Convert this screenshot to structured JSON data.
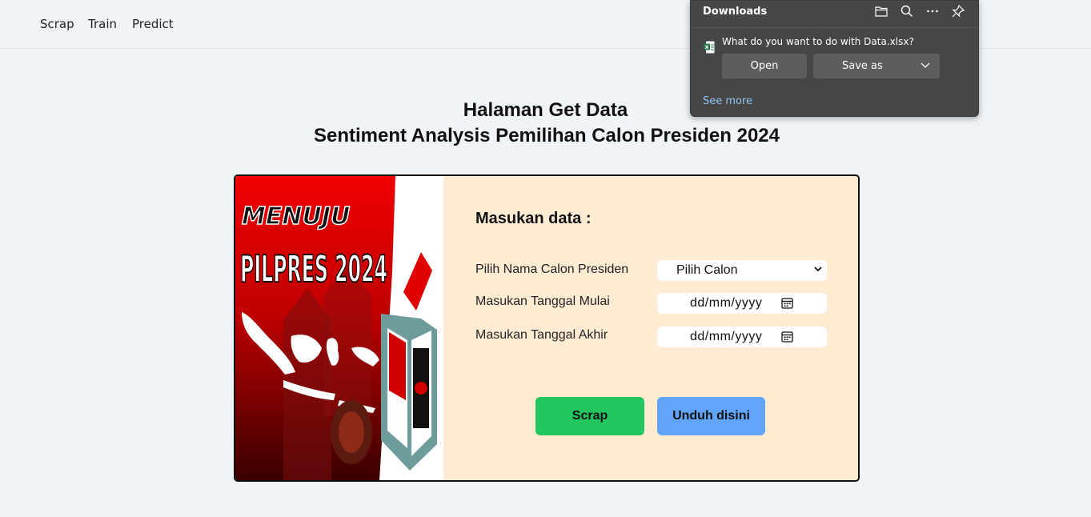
{
  "nav": {
    "items": [
      "Scrap",
      "Train",
      "Predict"
    ]
  },
  "header": {
    "title": "Halaman Get Data",
    "subtitle": "Sentiment Analysis Pemilihan Calon Presiden 2024"
  },
  "poster": {
    "line1": "MENUJU",
    "line2": "PILPRES 2024"
  },
  "form": {
    "title": "Masukan data :",
    "candidate_label": "Pilih Nama Calon Presiden",
    "candidate_value": "Pilih Calon",
    "start_label": "Masukan Tanggal Mulai",
    "start_value": "dd/mm/yyyy",
    "end_label": "Masukan Tanggal Akhir",
    "end_value": "dd/mm/yyyy",
    "scrap_button": "Scrap",
    "download_button": "Unduh disini"
  },
  "downloads": {
    "title": "Downloads",
    "question": "What do you want to do with Data.xlsx?",
    "open_button": "Open",
    "save_button": "Save as",
    "see_more": "See more",
    "icons": [
      "folder-icon",
      "search-icon",
      "more-icon",
      "pin-icon",
      "excel-file-icon",
      "chevron-down-icon"
    ]
  },
  "colors": {
    "page_bg": "#f0f3f8",
    "card_bg": "#ffecd3",
    "scrap_button": "#22c55e",
    "download_button": "#60a5fa",
    "popup_bg": "#464646",
    "link": "#8ec3f2"
  }
}
